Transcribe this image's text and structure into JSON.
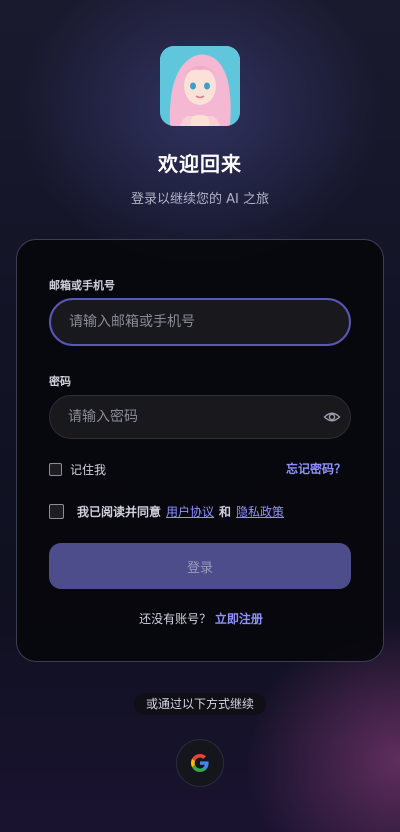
{
  "header": {
    "title": "欢迎回来",
    "subtitle": "登录以继续您的 AI 之旅"
  },
  "form": {
    "email_label": "邮箱或手机号",
    "email_placeholder": "请输入邮箱或手机号",
    "email_value": "",
    "password_label": "密码",
    "password_placeholder": "请输入密码",
    "password_value": "",
    "remember_label": "记住我",
    "forgot_label": "忘记密码？",
    "agree_prefix": "我已阅读并同意",
    "terms_label": "用户协议",
    "and_text": "和",
    "privacy_label": "隐私政策",
    "login_label": "登录",
    "no_account_text": "还没有账号？",
    "register_label": "立即注册"
  },
  "alt_login": {
    "divider_text": "或通过以下方式继续",
    "providers": [
      "google-icon"
    ]
  },
  "colors": {
    "accent": "#8f91ff",
    "button": "#4c4d8a",
    "card": "#06060a"
  }
}
